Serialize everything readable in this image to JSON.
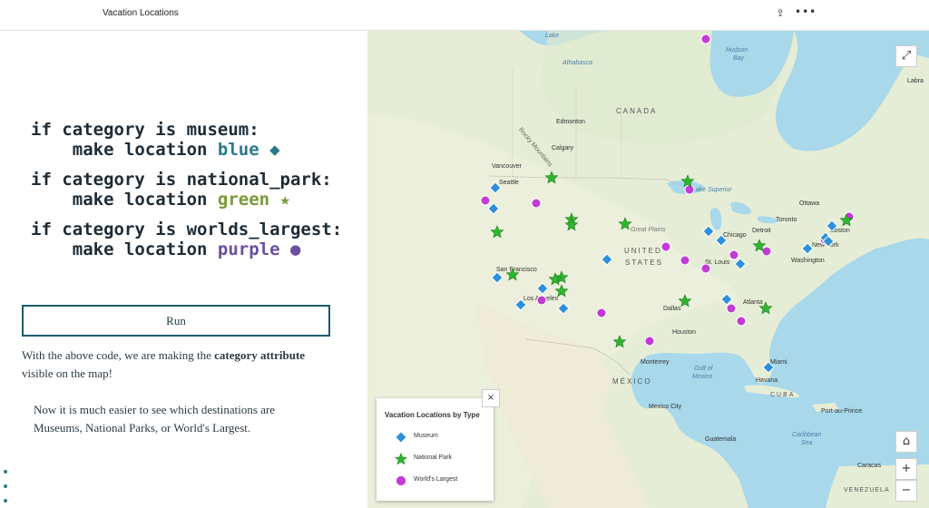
{
  "app": {
    "title": "Vacation Locations",
    "share_icon": "share-icon",
    "more_icon": "more-options-icon"
  },
  "code": {
    "l1": "if category is museum:",
    "l2a": "    make location ",
    "l2b": "blue",
    "l2c": " ◆",
    "l3": "if category is national_park:",
    "l4a": "    make location ",
    "l4b": "green",
    "l4c": " ★",
    "l5": "if category is worlds_largest:",
    "l6a": "    make location ",
    "l6b": "purple",
    "l6c": " ●"
  },
  "run_label": "Run",
  "para1": {
    "a": "With the above code, we are making the ",
    "b": "category attribute",
    "c": " visible on the map!"
  },
  "para2": "Now it is much easier to see which destinations are Museums, National Parks, or World's Largest.",
  "map": {
    "labels": {
      "lake": "Lake",
      "athabasca": "Athabasca",
      "hudson": "Hudson",
      "bay": "Bay",
      "labrador": "Labra",
      "canada": "CANADA",
      "edmonton": "Edmonton",
      "calgary": "Calgary",
      "vancouver": "Vancouver",
      "seattle": "Seattle",
      "rocky": "Rocky Mountains",
      "lake_superior": "Lake Superior",
      "ottawa": "Ottawa",
      "toronto": "Toronto",
      "boston": "Boston",
      "new_york": "New York",
      "washington": "Washington",
      "detroit": "Detroit",
      "chicago": "Chicago",
      "great_plains": "Great Plains",
      "united": "UNITED",
      "states": "STATES",
      "st_louis": "St. Louis",
      "san_francisco": "San Francisco",
      "los_angeles": "Los Angeles",
      "atlanta": "Atlanta",
      "dallas": "Dallas",
      "houston": "Houston",
      "monterrey": "Monterrey",
      "gulf": "Gulf of",
      "mexico_w": "Mexico",
      "mexico": "MÉXICO",
      "miami": "Miami",
      "havana": "Havana",
      "cuba": "CUBA",
      "mexico_city": "Mexico City",
      "port_au_prince": "Port-au-Prince",
      "caribbean": "Caribbean",
      "sea": "Sea",
      "guatemala": "Guatemala",
      "caracas": "Caracas",
      "venezuela": "VENEZUELA"
    },
    "legend": {
      "title": "Vacation Locations by Type",
      "items": [
        {
          "label": "Museum",
          "color": "#2e8fdc",
          "icon": "diamond-icon"
        },
        {
          "label": "National Park",
          "color": "#2fb52f",
          "icon": "star-icon"
        },
        {
          "label": "World's Largest",
          "color": "#c23bd4",
          "icon": "circle-icon"
        }
      ]
    },
    "colors": {
      "museum": "#2e8fdc",
      "park": "#2fb52f",
      "largest": "#c23bd4",
      "water": "#a8d8ea",
      "land": "#e8efd8"
    },
    "buttons": {
      "expand": "expand-icon",
      "home": "home-icon",
      "zoom_in": "+",
      "zoom_out": "−",
      "close": "×"
    }
  }
}
